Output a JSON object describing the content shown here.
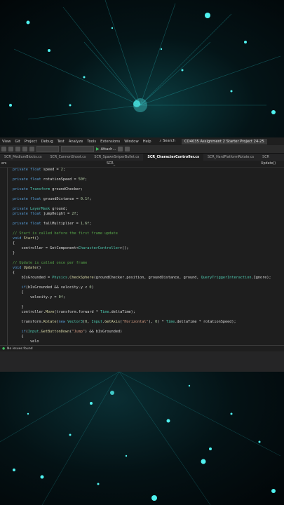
{
  "menu": [
    "View",
    "Git",
    "Project",
    "Debug",
    "Test",
    "Analyze",
    "Tools",
    "Extensions",
    "Window",
    "Help"
  ],
  "search_label": "Search",
  "project_title": "CO4035 Assignment 2 Starter Project 24-25",
  "toolbar": {
    "attach_label": "Attach..."
  },
  "tabs": [
    {
      "label": "SCR_MediumBlocks.cs",
      "active": false
    },
    {
      "label": "SCR_CannonShoot.cs",
      "active": false
    },
    {
      "label": "SCR_SpawnSniperBullet.cs",
      "active": false
    },
    {
      "label": "SCR_CharacterController.cs",
      "active": true
    },
    {
      "label": "SCR_HardPlatformRotate.cs",
      "active": false
    },
    {
      "label": "SCR",
      "active": false
    }
  ],
  "navbar": {
    "left": "ers",
    "middle": "SCR_",
    "right": "Update()"
  },
  "status": {
    "message": "No issues found"
  }
}
